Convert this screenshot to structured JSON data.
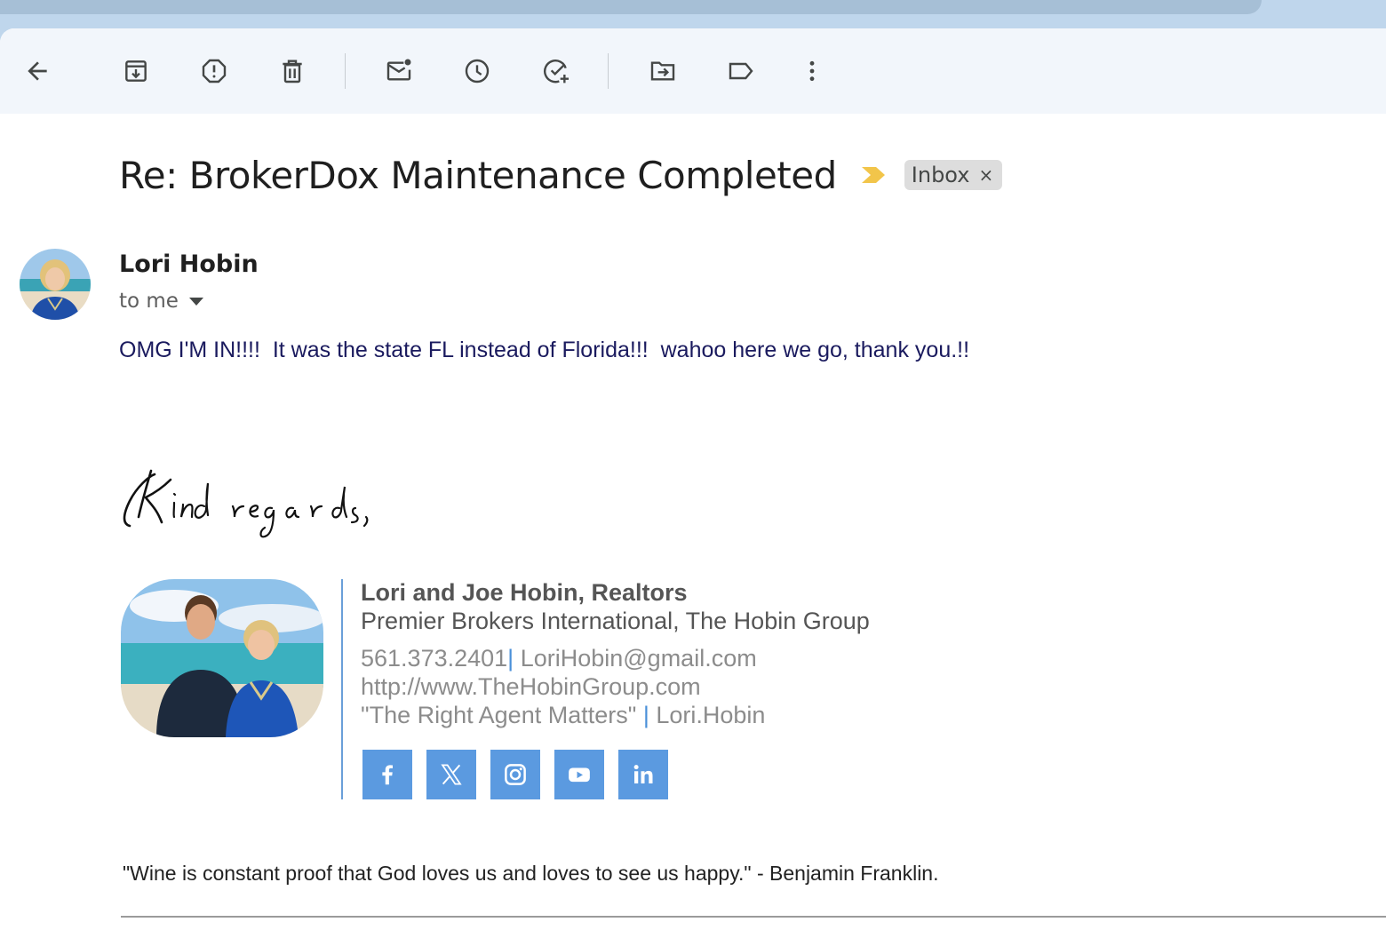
{
  "email": {
    "subject": "Re: BrokerDox Maintenance Completed",
    "label": "Inbox",
    "label_close": "×",
    "sender_name": "Lori Hobin",
    "recipient": "to me",
    "body": "OMG I'M IN!!!!  It was the state FL instead of Florida!!!  wahoo here we go, thank you.!!"
  },
  "toolbar": {
    "icons": [
      "back-arrow-icon",
      "archive-icon",
      "report-spam-icon",
      "delete-icon",
      "mark-unread-icon",
      "snooze-icon",
      "add-task-icon",
      "move-to-icon",
      "label-icon",
      "more-options-icon"
    ]
  },
  "signature": {
    "closing": "Kind regards,",
    "name": "Lori and Joe Hobin, Realtors",
    "company": "Premier Brokers International, The Hobin Group",
    "phone": "561.373.2401",
    "email": "LoriHobin@gmail.com",
    "website": "http://www.TheHobinGroup.com",
    "tagline": "\"The Right Agent Matters\"",
    "handle": "Lori.Hobin",
    "separator": "|",
    "social": [
      "facebook-icon",
      "x-icon",
      "instagram-icon",
      "youtube-icon",
      "linkedin-icon"
    ],
    "social_color": "#5b9ae0"
  },
  "quote": "\"Wine is constant proof that God loves us and loves to see us happy.\" - Benjamin Franklin."
}
